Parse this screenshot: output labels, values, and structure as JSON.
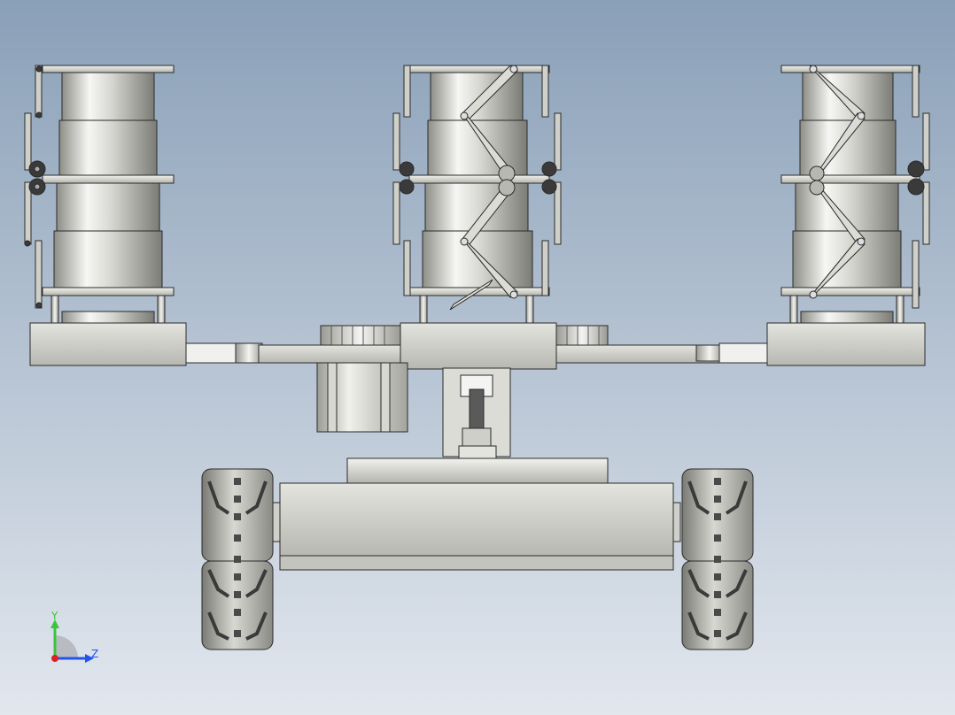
{
  "viewport": {
    "background_top": "#8aa0b8",
    "background_bottom": "#e2e7ee"
  },
  "model": {
    "outline_color": "#2a2a2a",
    "metal_light": "#f4f4f2",
    "metal_mid": "#c9c9c4",
    "metal_dark": "#8c8c86",
    "dark_part": "#3a3a3a"
  },
  "triad": {
    "y_label": "Y",
    "z_label": "Z",
    "y_color": "#3cc43c",
    "z_color": "#2255ee",
    "origin_color": "#dd2222",
    "sector_color": "#b8bcc2"
  }
}
